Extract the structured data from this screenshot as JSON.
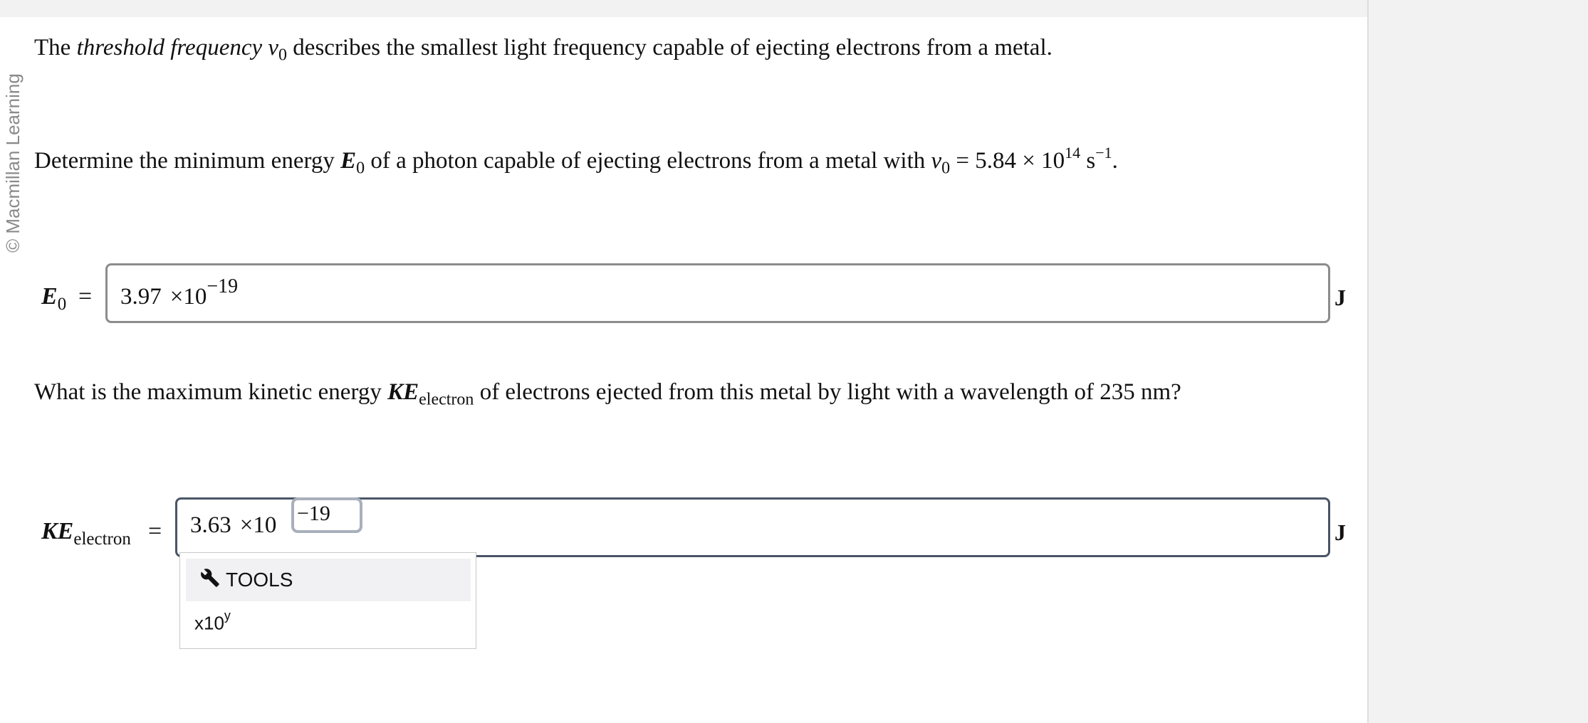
{
  "watermark": "© Macmillan Learning",
  "intro": {
    "prefix": "The ",
    "term": "threshold frequency",
    "symbol": "ν",
    "symbol_sub": "0",
    "suffix": " describes the smallest light frequency capable of ejecting electrons from a metal."
  },
  "question1": {
    "prefix": "Determine the minimum energy ",
    "symbol": "E",
    "symbol_sub": "0",
    "middle": " of a photon capable of ejecting electrons from a metal with ",
    "freq_symbol": "ν",
    "freq_sub": "0",
    "equals": " = 5.84 × 10",
    "exp": "14",
    "unit": " s",
    "unit_exp": "−1",
    "end": "."
  },
  "answer1": {
    "label": "E",
    "label_sub": "0",
    "equals": "=",
    "mantissa": "3.97",
    "times": "×10",
    "exponent": "−19",
    "unit": "J"
  },
  "question2": {
    "prefix": "What is the maximum kinetic energy ",
    "symbol": "KE",
    "symbol_sub": "electron",
    "suffix": " of electrons ejected from this metal by light with a wavelength of 235 nm?"
  },
  "answer2": {
    "label": "KE",
    "label_sub": "electron",
    "equals": "=",
    "mantissa": "3.63",
    "times": "×10",
    "exponent": "−19",
    "unit": "J"
  },
  "tools_menu": {
    "header": "TOOLS",
    "icon": "wrench-icon",
    "item_base": "x10",
    "item_exp": "y"
  }
}
